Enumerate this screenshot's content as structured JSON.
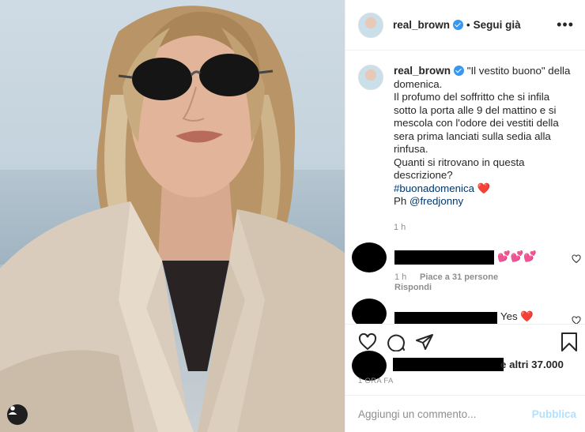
{
  "header": {
    "username": "real_brown",
    "separator": "•",
    "follow_label": "Segui già",
    "more": "•••"
  },
  "caption": {
    "username": "real_brown",
    "lines": [
      "\"Il vestito buono\" della",
      "domenica.",
      "Il profumo del soffritto che si infila",
      "sotto la porta alle 9 del mattino e si",
      "mescola con l'odore dei vestiti della",
      "sera prima lanciati sulla sedia alla",
      "rinfusa.",
      "Quanti si ritrovano in questa",
      "descrizione?"
    ],
    "hashtag": "#buonadomenica",
    "hashtag_emoji": "❤️",
    "credit_prefix": "Ph",
    "credit_handle": "@fredjonny",
    "ago": "1 h"
  },
  "comments": [
    {
      "text": "💕💕💕",
      "time": "1 h",
      "likes": "Piace a 31 persone",
      "reply": "Rispondi"
    },
    {
      "text": "Yes ❤️"
    }
  ],
  "likes": {
    "text": "e altri 37.000"
  },
  "timestamp": "1 ORA FA",
  "add_comment": {
    "placeholder": "Aggiungi un commento...",
    "publish_label": "Pubblica"
  },
  "icons": {
    "like": "heart-icon",
    "comment": "comment-icon",
    "share": "share-icon",
    "save": "bookmark-icon",
    "verified": "verified-badge-icon",
    "tagged": "user-tag-icon"
  },
  "colors": {
    "link": "#00376b",
    "verified": "#3897f0",
    "publish_disabled": "#b2dffc",
    "heart": "#ed4956"
  }
}
